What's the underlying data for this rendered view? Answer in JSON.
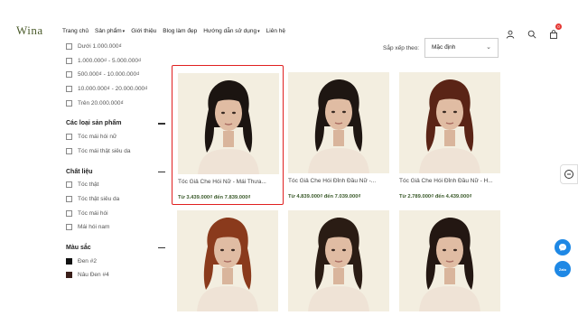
{
  "header": {
    "logo": "Wina",
    "nav": [
      {
        "label": "Trang chủ",
        "caret": false
      },
      {
        "label": "Sản phẩm",
        "caret": true
      },
      {
        "label": "Giới thiệu",
        "caret": false
      },
      {
        "label": "Blog làm đẹp",
        "caret": false
      },
      {
        "label": "Hướng dẫn sử dụng",
        "caret": true
      },
      {
        "label": "Liên hệ",
        "caret": false
      }
    ],
    "cart_count": "0"
  },
  "sidebar": {
    "price_items": [
      "Dưới 1.000.000₫",
      "1.000.000₫ - 5.000.000₫",
      "500.000₫ - 10.000.000₫",
      "10.000.000₫ - 20.000.000₫",
      "Trên 20.000.000₫"
    ],
    "type_title": "Các loại sản phẩm",
    "type_items": [
      "Tóc mái hói nữ",
      "Tóc mái thật siêu da"
    ],
    "material_title": "Chất liệu",
    "material_items": [
      "Tóc thật",
      "Tóc thật siêu da",
      "Tóc mái hói",
      "Mái hói nam"
    ],
    "color_title": "Màu sắc",
    "color_items": [
      {
        "label": "Đen #2",
        "color": "#111111"
      },
      {
        "label": "Nâu Đen #4",
        "color": "#3a1f1a"
      }
    ]
  },
  "sort": {
    "label": "Sắp xếp theo:",
    "value": "Mặc định"
  },
  "products": [
    {
      "name": "Tóc Giả Che Hói Nữ - Mái Thưa...",
      "price": "Từ 3.439.000₫ đến 7.839.000₫",
      "hair": "#1b1411"
    },
    {
      "name": "Tóc Giả Che Hói Đỉnh Đầu Nữ -...",
      "price": "Từ 4.839.000₫ đến 7.039.000₫",
      "hair": "#1e1612"
    },
    {
      "name": "Tóc Giả Che Hói Đỉnh Đầu Nữ - H...",
      "price": "Từ 2.789.000₫ đến 4.439.000₫",
      "hair": "#5a2416"
    },
    {
      "name": "",
      "price": "",
      "hair": "#8a3a1c"
    },
    {
      "name": "",
      "price": "",
      "hair": "#2a1c14"
    },
    {
      "name": "",
      "price": "",
      "hair": "#231712"
    }
  ]
}
